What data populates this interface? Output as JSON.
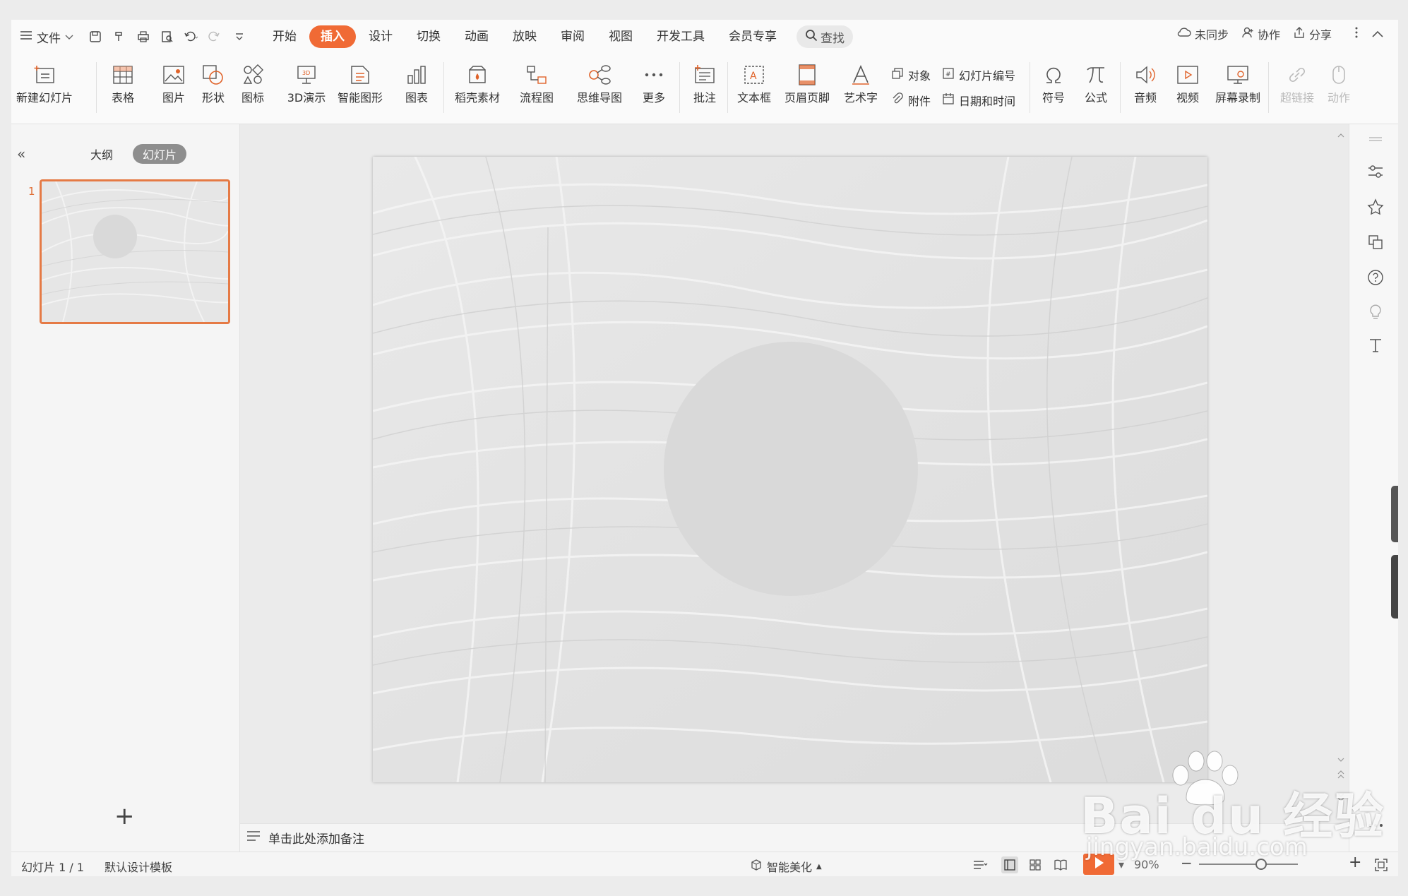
{
  "menubar": {
    "file_label": "文件",
    "tabs": [
      "开始",
      "插入",
      "设计",
      "切换",
      "动画",
      "放映",
      "审阅",
      "视图",
      "开发工具",
      "会员专享"
    ],
    "active_tab": "插入",
    "search_label": "查找",
    "right": {
      "sync": "未同步",
      "collab": "协作",
      "share": "分享"
    }
  },
  "ribbon": {
    "new_slide": "新建幻灯片",
    "table": "表格",
    "picture": "图片",
    "shape": "形状",
    "icon": "图标",
    "demo3d": "3D演示",
    "smartart": "智能图形",
    "chart": "图表",
    "material": "稻壳素材",
    "flowchart": "流程图",
    "mindmap": "思维导图",
    "more": "更多",
    "comment": "批注",
    "textbox": "文本框",
    "header_footer": "页眉页脚",
    "wordart": "艺术字",
    "object": "对象",
    "attachment": "附件",
    "slide_number": "幻灯片编号",
    "datetime": "日期和时间",
    "symbol": "符号",
    "formula": "公式",
    "audio": "音频",
    "video": "视频",
    "screen_record": "屏幕录制",
    "hyperlink": "超链接",
    "action": "动作"
  },
  "leftpanel": {
    "tab_outline": "大纲",
    "tab_slides": "幻灯片",
    "slide_number": "1"
  },
  "notes": {
    "placeholder": "单击此处添加备注"
  },
  "statusbar": {
    "slide_info": "幻灯片 1 / 1",
    "template": "默认设计模板",
    "beautify": "智能美化",
    "zoom": "90%"
  },
  "watermark": {
    "brand": "Bai du 经验",
    "url": "jingyan.baidu.com"
  },
  "colors": {
    "accent": "#f06a35",
    "thumb_border": "#e57a45",
    "circle": "#d9d9d9",
    "slide_bg": "#e5e5e5"
  }
}
